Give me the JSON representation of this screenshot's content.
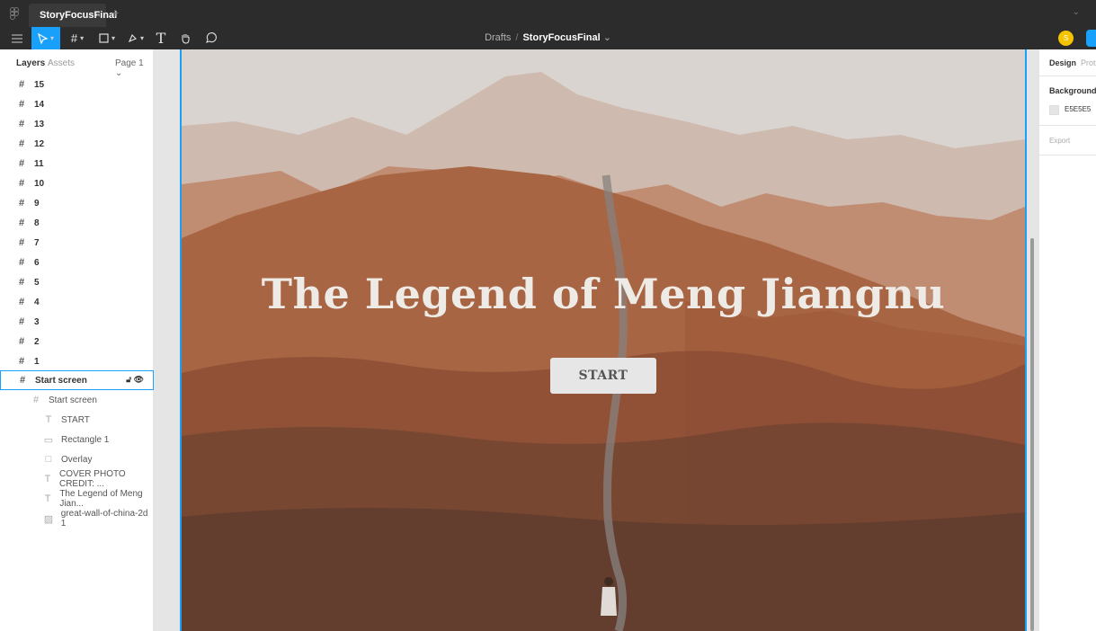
{
  "tabbar": {
    "tab_label": "StoryFocusFinal",
    "close": "×",
    "plus": "+",
    "menu_caret": "⌄"
  },
  "toolbar": {
    "breadcrumb_parent": "Drafts",
    "breadcrumb_sep": "/",
    "file_name": "StoryFocusFinal",
    "file_caret": "⌄",
    "avatar_initial": "S",
    "tools": [
      "menu-icon",
      "move-tool-icon",
      "frame-tool-icon",
      "shape-tool-icon",
      "pen-tool-icon",
      "text-tool-icon",
      "hand-tool-icon",
      "comment-tool-icon"
    ]
  },
  "left_panel": {
    "tab_layers": "Layers",
    "tab_assets": "Assets",
    "page_selector": "Page 1 ⌄",
    "frames": [
      "15",
      "14",
      "13",
      "12",
      "11",
      "10",
      "9",
      "8",
      "7",
      "6",
      "5",
      "4",
      "3",
      "2",
      "1"
    ],
    "selected_frame": "Start screen",
    "children": {
      "group": "Start screen",
      "start_text": "START",
      "rectangle": "Rectangle 1",
      "overlay": "Overlay",
      "credit": "COVER PHOTO CREDIT: ...",
      "title_text": "The Legend of Meng Jian...",
      "image": "great-wall-of-china-2d 1"
    }
  },
  "canvas": {
    "title": "The Legend of Meng Jiangnu",
    "start_button": "START",
    "colors": {
      "sky": "#e6e6e6",
      "overlay_brown": "#a0583a",
      "selection": "#18a0fb"
    }
  },
  "right_panel": {
    "tab_design": "Design",
    "tab_prototype": "Prot",
    "background_label": "Background",
    "background_hex": "E5E5E5",
    "export_label": "Export"
  }
}
